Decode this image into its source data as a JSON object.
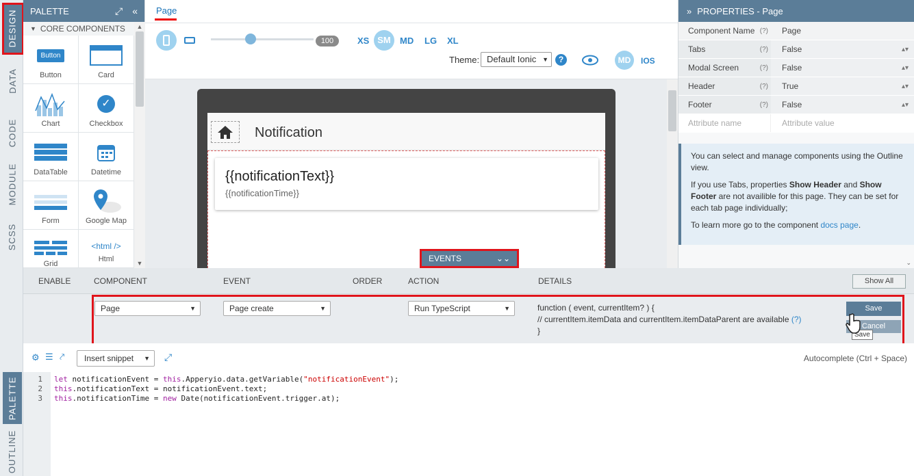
{
  "vertical_tabs": {
    "design": "DESIGN",
    "data": "DATA",
    "code": "CODE",
    "module": "MODULE",
    "scss": "SCSS",
    "palette": "PALETTE",
    "outline": "OUTLINE"
  },
  "palette": {
    "title": "PALETTE",
    "section": "CORE COMPONENTS",
    "items": [
      {
        "label": "Button",
        "icon_text": "Button"
      },
      {
        "label": "Card"
      },
      {
        "label": "Chart"
      },
      {
        "label": "Checkbox"
      },
      {
        "label": "DataTable"
      },
      {
        "label": "Datetime"
      },
      {
        "label": "Form"
      },
      {
        "label": "Google Map"
      },
      {
        "label": "Grid"
      },
      {
        "label": "Html",
        "icon_text": "<html />"
      }
    ]
  },
  "page_tab": "Page",
  "toolbar": {
    "zoom": "100",
    "sizes": [
      "XS",
      "SM",
      "MD",
      "LG",
      "XL"
    ],
    "theme_label": "Theme:",
    "theme_value": "Default Ionic",
    "help": "?",
    "md": "MD",
    "ios": "IOS"
  },
  "preview": {
    "title": "Notification",
    "card_title": "{{notificationText}}",
    "card_sub": "{{notificationTime}}",
    "events_label": "EVENTS"
  },
  "properties": {
    "title": "PROPERTIES - Page",
    "rows": [
      {
        "name": "Component Name",
        "help": "(?)",
        "value": "Page"
      },
      {
        "name": "Tabs",
        "help": "(?)",
        "value": "False"
      },
      {
        "name": "Modal Screen",
        "help": "(?)",
        "value": "False"
      },
      {
        "name": "Header",
        "help": "(?)",
        "value": "True"
      },
      {
        "name": "Footer",
        "help": "(?)",
        "value": "False"
      }
    ],
    "attr_name_placeholder": "Attribute name",
    "attr_value_placeholder": "Attribute value",
    "info1": "You can select and manage components using the Outline view.",
    "info2a": "If you use Tabs, properties ",
    "info2b": "Show Header",
    "info2c": " and ",
    "info2d": "Show Footer",
    "info2e": " are not availible for this page. They can be set for each tab page individually;",
    "info3a": "To learn more go to the component ",
    "info3b": "docs page",
    "info3c": "."
  },
  "events": {
    "headers": {
      "enable": "ENABLE",
      "component": "COMPONENT",
      "event": "EVENT",
      "order": "ORDER",
      "action": "ACTION",
      "details": "DETAILS"
    },
    "show_all": "Show All",
    "row": {
      "component": "Page",
      "event": "Page create",
      "action": "Run TypeScript",
      "details1": "function ( event, currentItem? ) {",
      "details2": "// currentItem.itemData and currentItem.itemDataParent are available ",
      "details2_link": "(?)",
      "details3": "}",
      "save": "Save",
      "cancel": "Cancel",
      "tooltip": "Save"
    }
  },
  "editor": {
    "snippet": "Insert snippet",
    "autocomplete": "Autocomplete (Ctrl + Space)",
    "line_numbers": [
      "1",
      "2",
      "3"
    ]
  },
  "colors": {
    "accent": "#5b7d98",
    "link": "#2f86c9",
    "highlight": "#e0141b"
  }
}
